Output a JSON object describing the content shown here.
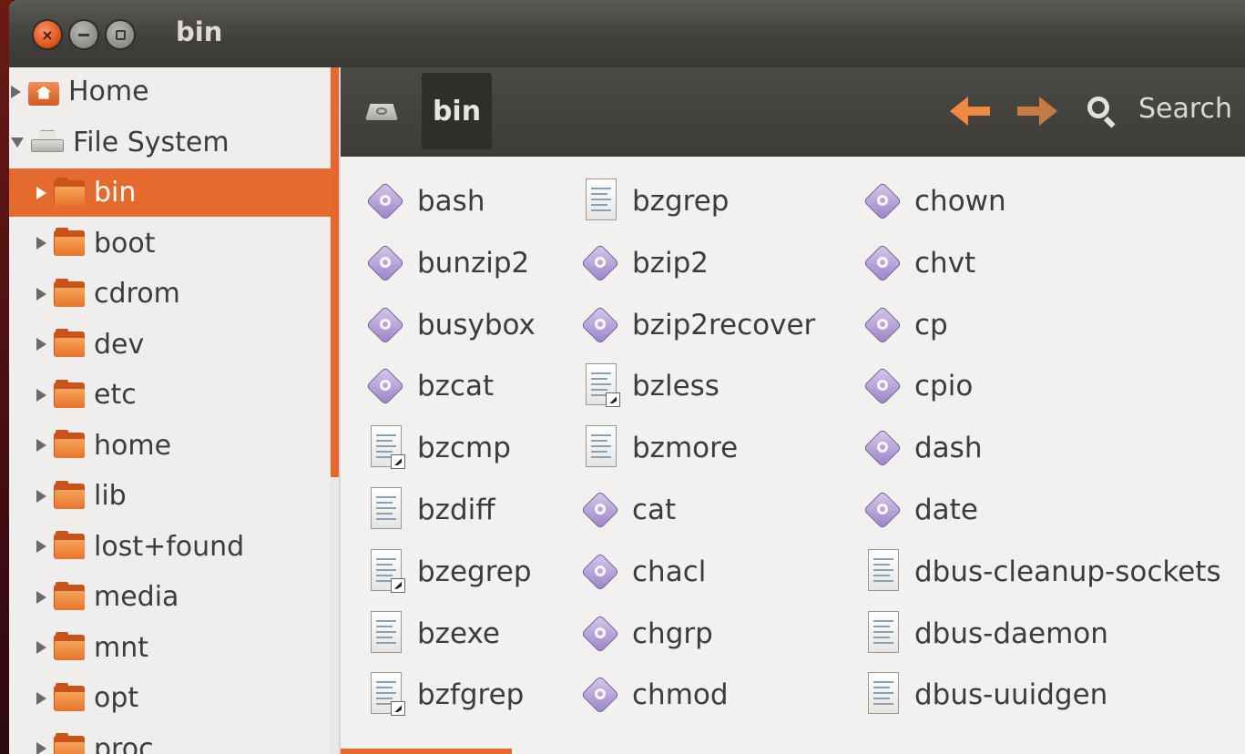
{
  "window": {
    "title": "bin"
  },
  "colors": {
    "accent": "#e46a2e",
    "titlebar": "#403f3b",
    "exec_icon": "#9a84c6"
  },
  "sidebar": {
    "items": [
      {
        "label": "Home",
        "icon": "home-folder-icon",
        "expander": "collapsed",
        "selected": false,
        "level": 0
      },
      {
        "label": "File System",
        "icon": "drive-icon",
        "expander": "expanded",
        "selected": false,
        "level": 0
      },
      {
        "label": "bin",
        "icon": "folder-icon",
        "expander": "collapsed",
        "selected": true,
        "level": 1
      },
      {
        "label": "boot",
        "icon": "folder-icon",
        "expander": "collapsed",
        "selected": false,
        "level": 1
      },
      {
        "label": "cdrom",
        "icon": "folder-icon",
        "expander": "collapsed",
        "selected": false,
        "level": 1
      },
      {
        "label": "dev",
        "icon": "folder-icon",
        "expander": "collapsed",
        "selected": false,
        "level": 1
      },
      {
        "label": "etc",
        "icon": "folder-icon",
        "expander": "collapsed",
        "selected": false,
        "level": 1
      },
      {
        "label": "home",
        "icon": "folder-icon",
        "expander": "collapsed",
        "selected": false,
        "level": 1
      },
      {
        "label": "lib",
        "icon": "folder-icon",
        "expander": "collapsed",
        "selected": false,
        "level": 1
      },
      {
        "label": "lost+found",
        "icon": "folder-icon",
        "expander": "collapsed",
        "selected": false,
        "level": 1
      },
      {
        "label": "media",
        "icon": "folder-icon",
        "expander": "collapsed",
        "selected": false,
        "level": 1
      },
      {
        "label": "mnt",
        "icon": "folder-icon",
        "expander": "collapsed",
        "selected": false,
        "level": 1
      },
      {
        "label": "opt",
        "icon": "folder-icon",
        "expander": "collapsed",
        "selected": false,
        "level": 1
      },
      {
        "label": "proc",
        "icon": "folder-icon",
        "expander": "collapsed",
        "selected": false,
        "level": 1
      }
    ]
  },
  "toolbar": {
    "breadcrumb": {
      "root_icon": "drive-icon",
      "current": "bin"
    },
    "back_icon": "back-arrow-icon",
    "forward_icon": "forward-arrow-icon",
    "search_icon": "search-icon",
    "search_label": "Search"
  },
  "files": {
    "columns": [
      [
        {
          "name": "bash",
          "type": "executable"
        },
        {
          "name": "bunzip2",
          "type": "executable"
        },
        {
          "name": "busybox",
          "type": "executable"
        },
        {
          "name": "bzcat",
          "type": "executable"
        },
        {
          "name": "bzcmp",
          "type": "text-link"
        },
        {
          "name": "bzdiff",
          "type": "text"
        },
        {
          "name": "bzegrep",
          "type": "text-link"
        },
        {
          "name": "bzexe",
          "type": "text"
        },
        {
          "name": "bzfgrep",
          "type": "text-link"
        }
      ],
      [
        {
          "name": "bzgrep",
          "type": "text"
        },
        {
          "name": "bzip2",
          "type": "executable"
        },
        {
          "name": "bzip2recover",
          "type": "executable"
        },
        {
          "name": "bzless",
          "type": "text-link"
        },
        {
          "name": "bzmore",
          "type": "text"
        },
        {
          "name": "cat",
          "type": "executable"
        },
        {
          "name": "chacl",
          "type": "executable"
        },
        {
          "name": "chgrp",
          "type": "executable"
        },
        {
          "name": "chmod",
          "type": "executable"
        }
      ],
      [
        {
          "name": "chown",
          "type": "executable"
        },
        {
          "name": "chvt",
          "type": "executable"
        },
        {
          "name": "cp",
          "type": "executable"
        },
        {
          "name": "cpio",
          "type": "executable"
        },
        {
          "name": "dash",
          "type": "executable"
        },
        {
          "name": "date",
          "type": "executable"
        },
        {
          "name": "dbus-cleanup-sockets",
          "type": "text"
        },
        {
          "name": "dbus-daemon",
          "type": "text"
        },
        {
          "name": "dbus-uuidgen",
          "type": "text"
        }
      ]
    ]
  }
}
